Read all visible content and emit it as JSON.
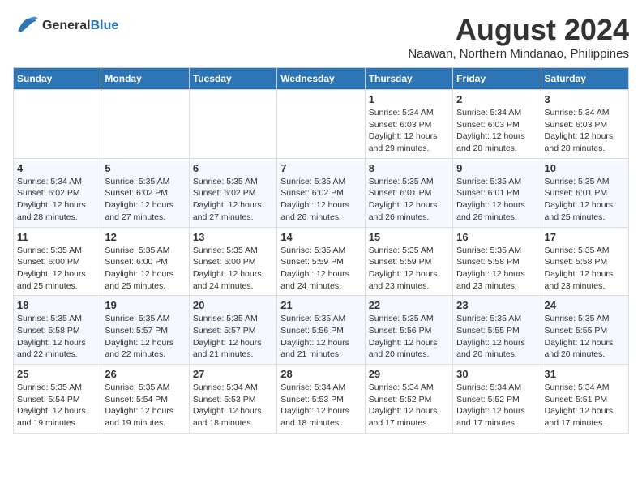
{
  "logo": {
    "line1": "General",
    "line2": "Blue"
  },
  "title": "August 2024",
  "subtitle": "Naawan, Northern Mindanao, Philippines",
  "weekdays": [
    "Sunday",
    "Monday",
    "Tuesday",
    "Wednesday",
    "Thursday",
    "Friday",
    "Saturday"
  ],
  "weeks": [
    [
      {
        "day": "",
        "info": ""
      },
      {
        "day": "",
        "info": ""
      },
      {
        "day": "",
        "info": ""
      },
      {
        "day": "",
        "info": ""
      },
      {
        "day": "1",
        "info": "Sunrise: 5:34 AM\nSunset: 6:03 PM\nDaylight: 12 hours\nand 29 minutes."
      },
      {
        "day": "2",
        "info": "Sunrise: 5:34 AM\nSunset: 6:03 PM\nDaylight: 12 hours\nand 28 minutes."
      },
      {
        "day": "3",
        "info": "Sunrise: 5:34 AM\nSunset: 6:03 PM\nDaylight: 12 hours\nand 28 minutes."
      }
    ],
    [
      {
        "day": "4",
        "info": "Sunrise: 5:34 AM\nSunset: 6:02 PM\nDaylight: 12 hours\nand 28 minutes."
      },
      {
        "day": "5",
        "info": "Sunrise: 5:35 AM\nSunset: 6:02 PM\nDaylight: 12 hours\nand 27 minutes."
      },
      {
        "day": "6",
        "info": "Sunrise: 5:35 AM\nSunset: 6:02 PM\nDaylight: 12 hours\nand 27 minutes."
      },
      {
        "day": "7",
        "info": "Sunrise: 5:35 AM\nSunset: 6:02 PM\nDaylight: 12 hours\nand 26 minutes."
      },
      {
        "day": "8",
        "info": "Sunrise: 5:35 AM\nSunset: 6:01 PM\nDaylight: 12 hours\nand 26 minutes."
      },
      {
        "day": "9",
        "info": "Sunrise: 5:35 AM\nSunset: 6:01 PM\nDaylight: 12 hours\nand 26 minutes."
      },
      {
        "day": "10",
        "info": "Sunrise: 5:35 AM\nSunset: 6:01 PM\nDaylight: 12 hours\nand 25 minutes."
      }
    ],
    [
      {
        "day": "11",
        "info": "Sunrise: 5:35 AM\nSunset: 6:00 PM\nDaylight: 12 hours\nand 25 minutes."
      },
      {
        "day": "12",
        "info": "Sunrise: 5:35 AM\nSunset: 6:00 PM\nDaylight: 12 hours\nand 25 minutes."
      },
      {
        "day": "13",
        "info": "Sunrise: 5:35 AM\nSunset: 6:00 PM\nDaylight: 12 hours\nand 24 minutes."
      },
      {
        "day": "14",
        "info": "Sunrise: 5:35 AM\nSunset: 5:59 PM\nDaylight: 12 hours\nand 24 minutes."
      },
      {
        "day": "15",
        "info": "Sunrise: 5:35 AM\nSunset: 5:59 PM\nDaylight: 12 hours\nand 23 minutes."
      },
      {
        "day": "16",
        "info": "Sunrise: 5:35 AM\nSunset: 5:58 PM\nDaylight: 12 hours\nand 23 minutes."
      },
      {
        "day": "17",
        "info": "Sunrise: 5:35 AM\nSunset: 5:58 PM\nDaylight: 12 hours\nand 23 minutes."
      }
    ],
    [
      {
        "day": "18",
        "info": "Sunrise: 5:35 AM\nSunset: 5:58 PM\nDaylight: 12 hours\nand 22 minutes."
      },
      {
        "day": "19",
        "info": "Sunrise: 5:35 AM\nSunset: 5:57 PM\nDaylight: 12 hours\nand 22 minutes."
      },
      {
        "day": "20",
        "info": "Sunrise: 5:35 AM\nSunset: 5:57 PM\nDaylight: 12 hours\nand 21 minutes."
      },
      {
        "day": "21",
        "info": "Sunrise: 5:35 AM\nSunset: 5:56 PM\nDaylight: 12 hours\nand 21 minutes."
      },
      {
        "day": "22",
        "info": "Sunrise: 5:35 AM\nSunset: 5:56 PM\nDaylight: 12 hours\nand 20 minutes."
      },
      {
        "day": "23",
        "info": "Sunrise: 5:35 AM\nSunset: 5:55 PM\nDaylight: 12 hours\nand 20 minutes."
      },
      {
        "day": "24",
        "info": "Sunrise: 5:35 AM\nSunset: 5:55 PM\nDaylight: 12 hours\nand 20 minutes."
      }
    ],
    [
      {
        "day": "25",
        "info": "Sunrise: 5:35 AM\nSunset: 5:54 PM\nDaylight: 12 hours\nand 19 minutes."
      },
      {
        "day": "26",
        "info": "Sunrise: 5:35 AM\nSunset: 5:54 PM\nDaylight: 12 hours\nand 19 minutes."
      },
      {
        "day": "27",
        "info": "Sunrise: 5:34 AM\nSunset: 5:53 PM\nDaylight: 12 hours\nand 18 minutes."
      },
      {
        "day": "28",
        "info": "Sunrise: 5:34 AM\nSunset: 5:53 PM\nDaylight: 12 hours\nand 18 minutes."
      },
      {
        "day": "29",
        "info": "Sunrise: 5:34 AM\nSunset: 5:52 PM\nDaylight: 12 hours\nand 17 minutes."
      },
      {
        "day": "30",
        "info": "Sunrise: 5:34 AM\nSunset: 5:52 PM\nDaylight: 12 hours\nand 17 minutes."
      },
      {
        "day": "31",
        "info": "Sunrise: 5:34 AM\nSunset: 5:51 PM\nDaylight: 12 hours\nand 17 minutes."
      }
    ]
  ]
}
